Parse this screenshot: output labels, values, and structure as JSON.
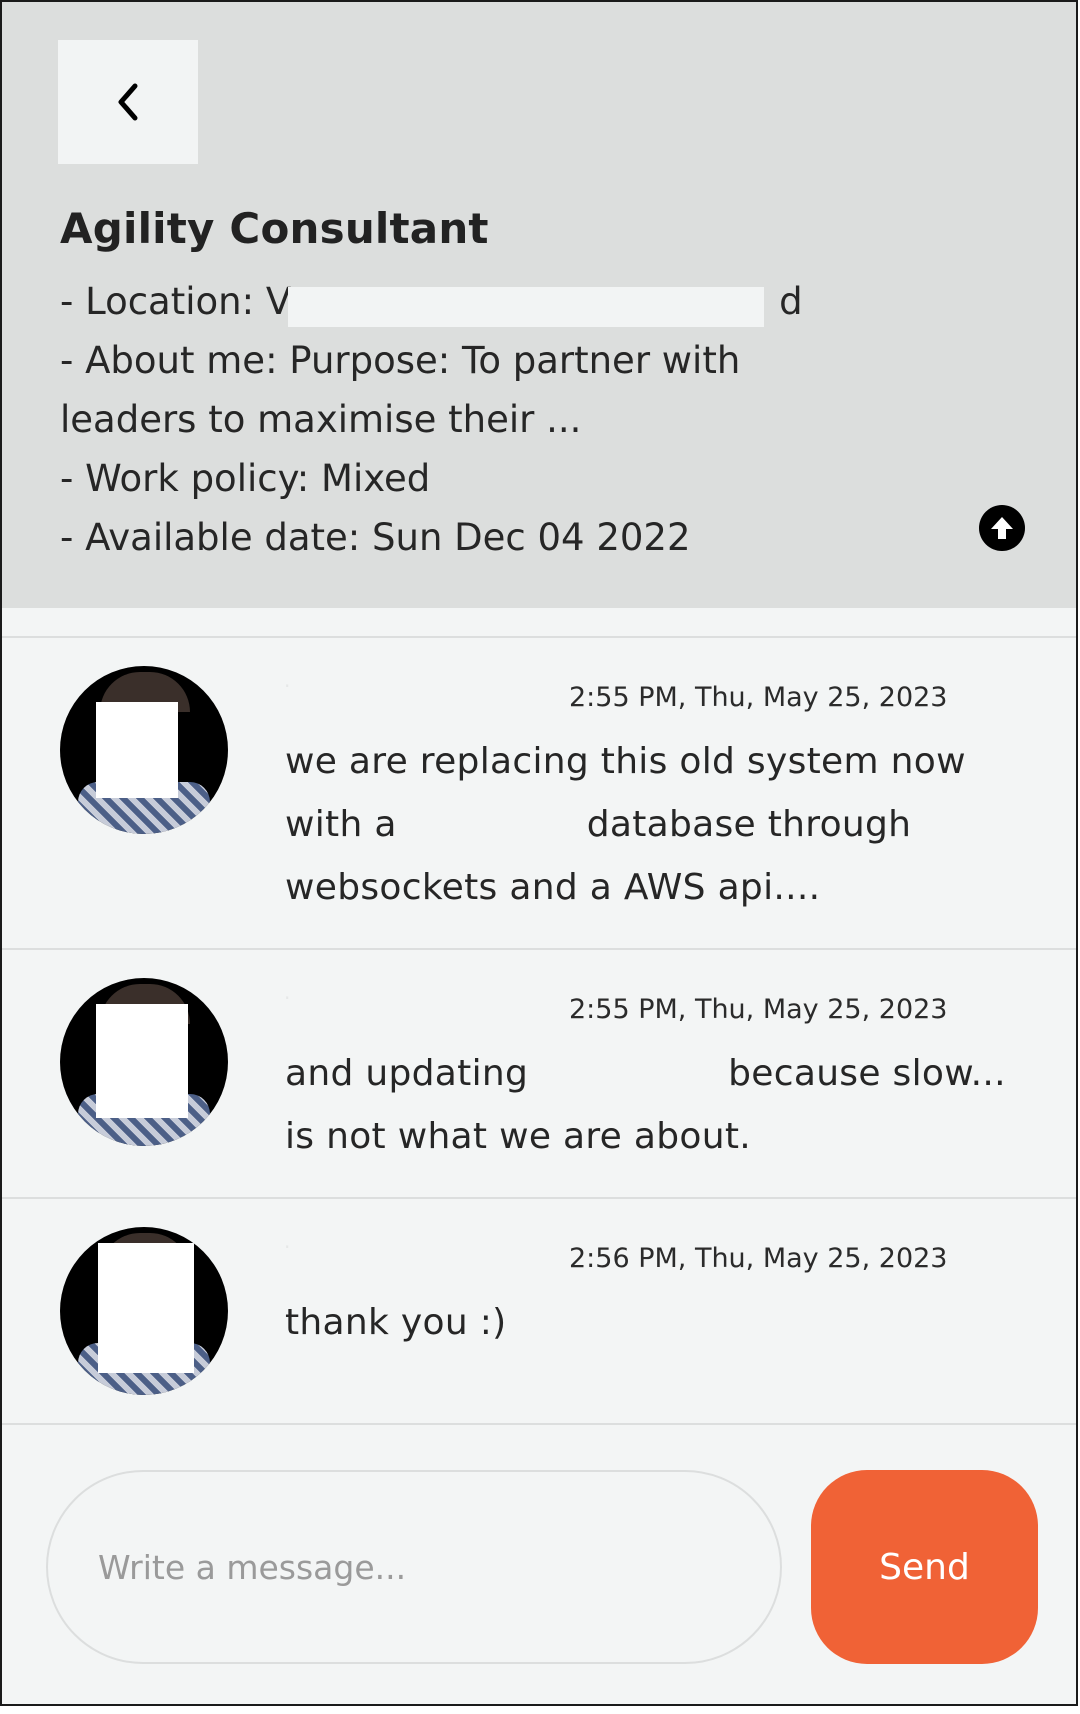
{
  "header": {
    "title": "Agility Consultant",
    "info": [
      "- Location: V",
      "- About me: Purpose: To partner with",
      "leaders to maximise their ...",
      "- Work policy: Mixed",
      "- Available date: Sun Dec 04 2022"
    ],
    "location_tail": "d",
    "icons": {
      "back": "chevron-left-icon",
      "scroll": "arrow-up-circle-icon"
    }
  },
  "messages": [
    {
      "timestamp": "2:55 PM, Thu, May 25, 2023",
      "text_before": "we are replacing this old system now with a",
      "text_after": "database through websockets and a AWS api...."
    },
    {
      "timestamp": "2:55 PM, Thu, May 25, 2023",
      "text_before": "and updating",
      "text_after": "because slow... is not what we are about."
    },
    {
      "timestamp": "2:56 PM, Thu, May 25, 2023",
      "text_before": "thank you :)",
      "text_after": ""
    }
  ],
  "composer": {
    "placeholder": "Write a message...",
    "send_label": "Send"
  },
  "colors": {
    "header_bg": "#dcdedd",
    "page_bg": "#f3f5f5",
    "send_button": "#f06236",
    "divider": "#dcdede"
  }
}
